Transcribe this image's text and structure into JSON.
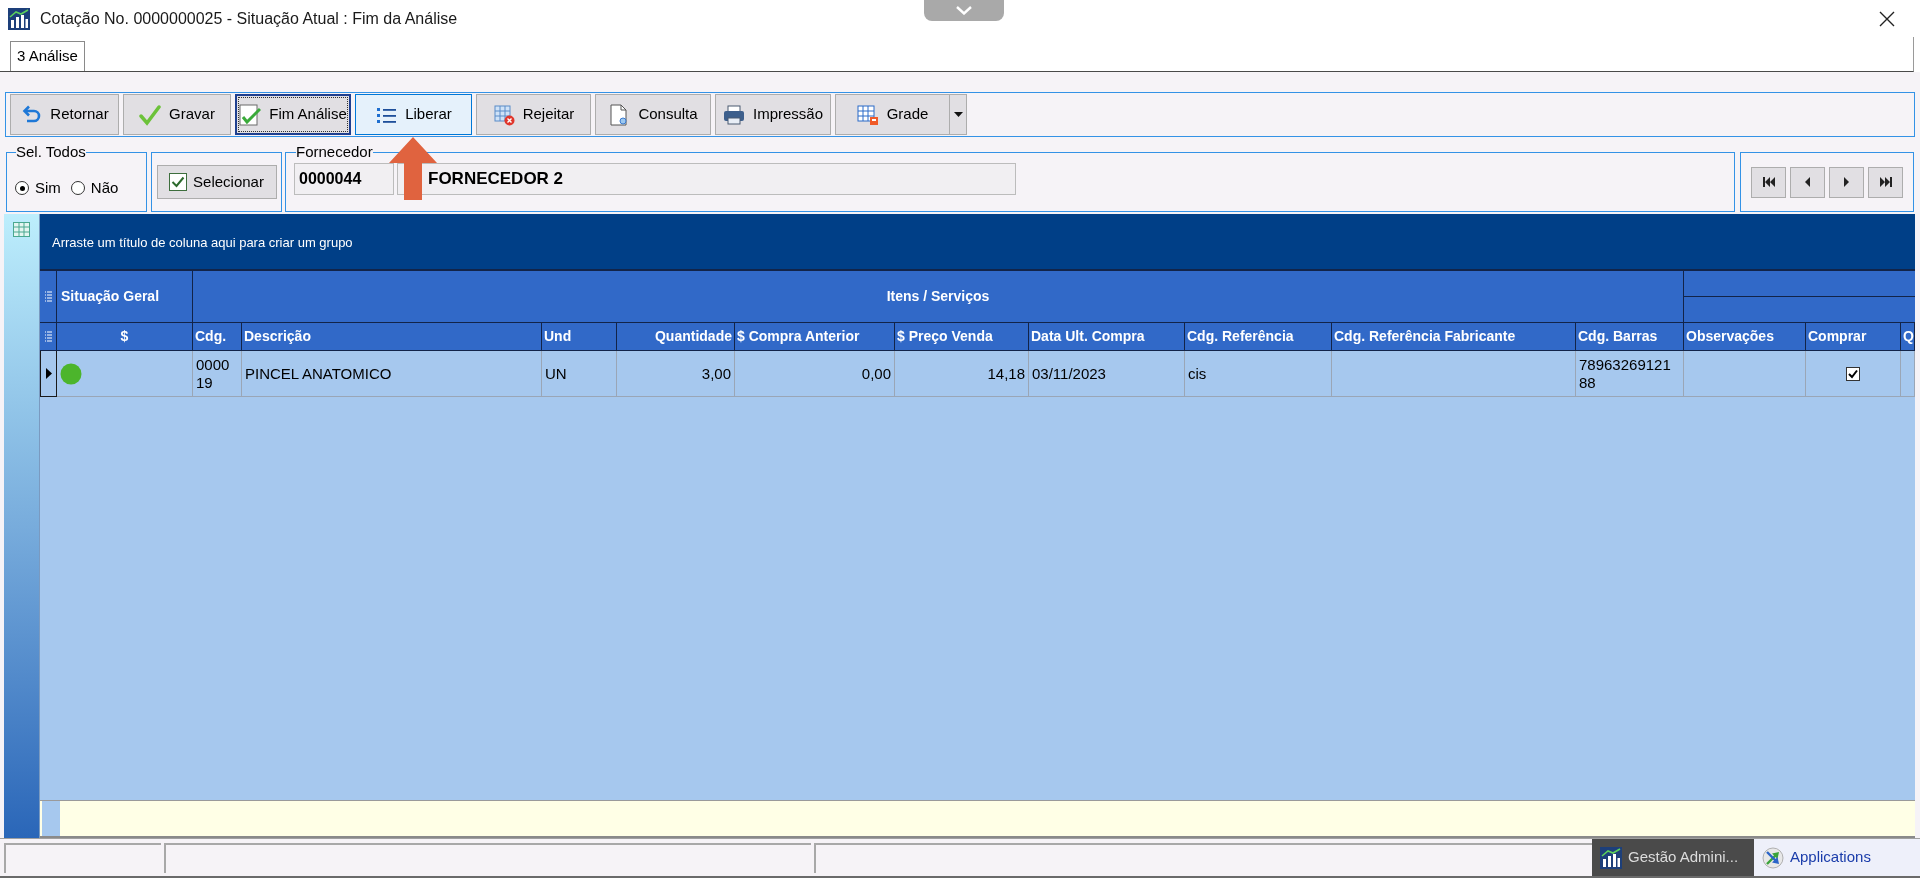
{
  "window": {
    "title": "Cotação No. 0000000025 - Situação Atual : Fim da Análise"
  },
  "tabs": [
    {
      "label": "3 Análise",
      "selected": true
    }
  ],
  "toolbar": [
    {
      "label": "Retornar",
      "focused": false,
      "hovered": false
    },
    {
      "label": "Gravar",
      "focused": false,
      "hovered": false
    },
    {
      "label": "Fim Análise",
      "focused": true,
      "hovered": false
    },
    {
      "label": "Liberar",
      "focused": false,
      "hovered": true
    },
    {
      "label": "Rejeitar",
      "focused": false,
      "hovered": false
    },
    {
      "label": "Consulta",
      "focused": false,
      "hovered": false
    },
    {
      "label": "Impressão",
      "focused": false,
      "hovered": false
    },
    {
      "label": "Grade",
      "focused": false,
      "hovered": false
    }
  ],
  "sel_todos": {
    "label": "Sel. Todos",
    "options": [
      {
        "label": "Sim",
        "selected": true
      },
      {
        "label": "Não",
        "selected": false
      }
    ]
  },
  "selecionar": {
    "label": "Selecionar",
    "checked": true
  },
  "fornecedor": {
    "label": "Fornecedor",
    "code": "0000044",
    "name": "FORNECEDOR 2"
  },
  "grid": {
    "group_hint": "Arraste um título de coluna aqui para criar um grupo",
    "bands": [
      {
        "label": "Situação Geral"
      },
      {
        "label": "Itens / Serviços"
      }
    ],
    "columns": [
      {
        "label": "$"
      },
      {
        "label": "Cdg."
      },
      {
        "label": "Descrição"
      },
      {
        "label": "Und"
      },
      {
        "label": "Quantidade"
      },
      {
        "label": "$ Compra Anterior"
      },
      {
        "label": "$ Preço Venda"
      },
      {
        "label": "Data Ult. Compra"
      },
      {
        "label": "Cdg. Referência"
      },
      {
        "label": "Cdg. Referência Fabricante"
      },
      {
        "label": "Cdg. Barras"
      },
      {
        "label": "Observações"
      },
      {
        "label": "Comprar"
      },
      {
        "label": "Q"
      }
    ],
    "rows": [
      {
        "selected": true,
        "color": "#4cb52c",
        "cdg": "000019",
        "descricao": "PINCEL ANATOMICO",
        "und": "UN",
        "quantidade": "3,00",
        "compra_anterior": "0,00",
        "preco_venda": "14,18",
        "data_ult_compra": "03/11/2023",
        "cdg_referencia": "cis",
        "cdg_barras": "7896326912188",
        "comprar": true
      }
    ]
  },
  "status_bar": {
    "taskbar": [
      {
        "label": "Gestão Admini...",
        "active": true
      },
      {
        "label": "Applications",
        "active": false
      }
    ]
  }
}
